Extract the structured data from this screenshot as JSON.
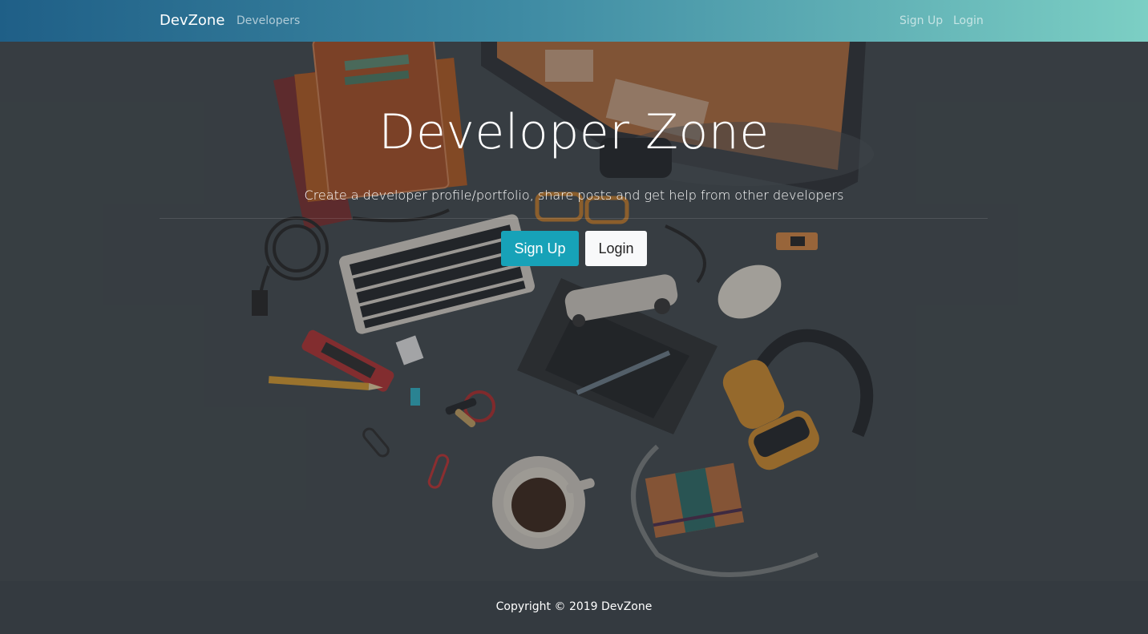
{
  "navbar": {
    "brand": "DevZone",
    "links": [
      "Developers"
    ],
    "auth": {
      "signup": "Sign Up",
      "login": "Login"
    }
  },
  "hero": {
    "title": "Developer Zone",
    "lead": "Create a developer profile/portfolio, share posts and get help from other developers",
    "buttons": {
      "signup": "Sign Up",
      "login": "Login"
    }
  },
  "footer": {
    "copyright": "Copyright © 2019 DevZone"
  },
  "colors": {
    "primary": "#17a2b8",
    "footer_bg": "#343a40",
    "nav_gradient_start": "#1f5f87",
    "nav_gradient_end": "#7ccfc4"
  }
}
